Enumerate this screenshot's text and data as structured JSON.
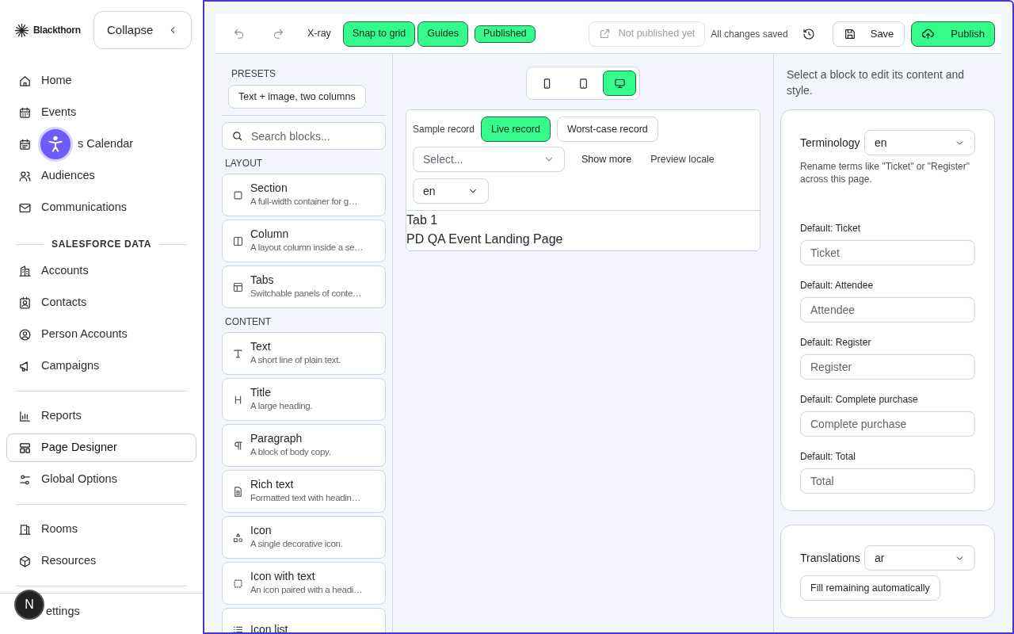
{
  "brand": {
    "name": "Blackthorn"
  },
  "collapse_button": {
    "label": "Collapse"
  },
  "sidebar": {
    "groups": [
      {
        "items": [
          {
            "label": "Home",
            "selected": false
          },
          {
            "label": "Events",
            "selected": false
          },
          {
            "label": "s Calendar",
            "selected": false
          },
          {
            "label": "Audiences",
            "selected": false
          },
          {
            "label": "Communications",
            "selected": false
          }
        ]
      },
      {
        "heading": "SALESFORCE DATA",
        "items": [
          {
            "label": "Accounts",
            "selected": false
          },
          {
            "label": "Contacts",
            "selected": false
          },
          {
            "label": "Person Accounts",
            "selected": false
          },
          {
            "label": "Campaigns",
            "selected": false
          }
        ]
      },
      {
        "items": [
          {
            "label": "Reports",
            "selected": false
          },
          {
            "label": "Page Designer",
            "selected": true
          },
          {
            "label": "Global Options",
            "selected": false
          }
        ]
      },
      {
        "items": [
          {
            "label": "Rooms",
            "selected": false
          },
          {
            "label": "Resources",
            "selected": false
          }
        ]
      }
    ],
    "footer_item": {
      "label": "ettings"
    },
    "avatar": {
      "initial": "N"
    }
  },
  "toolbar": {
    "toggles": [
      {
        "label": "X-ray",
        "on": false
      },
      {
        "label": "Snap to grid",
        "on": true
      },
      {
        "label": "Guides",
        "on": true
      }
    ],
    "status_badge": "Published",
    "view_link": {
      "label": "Not published yet",
      "disabled": true
    },
    "save_status": "All changes saved",
    "save_button": "Save",
    "publish_button": "Publish"
  },
  "blocks_panel": {
    "presets_heading": "PRESETS",
    "preset": "Text + image, two columns",
    "search": {
      "placeholder": "Search blocks..."
    },
    "sections": [
      {
        "heading": "LAYOUT",
        "blocks": [
          {
            "title": "Section",
            "description": "A full-width container for g…"
          },
          {
            "title": "Column",
            "description": "A layout column inside a se…"
          },
          {
            "title": "Tabs",
            "description": "Switchable panels of conte…"
          }
        ]
      },
      {
        "heading": "CONTENT",
        "blocks": [
          {
            "title": "Text",
            "description": "A short line of plain text."
          },
          {
            "title": "Title",
            "description": "A large heading."
          },
          {
            "title": "Paragraph",
            "description": "A block of body copy."
          },
          {
            "title": "Rich text",
            "description": "Formatted text with headin…"
          },
          {
            "title": "Icon",
            "description": "A single decorative icon."
          },
          {
            "title": "Icon with text",
            "description": "An icon paired with a headi…"
          },
          {
            "title": "Icon list"
          }
        ]
      }
    ]
  },
  "canvas": {
    "devices": [
      {
        "kind": "phone",
        "selected": false
      },
      {
        "kind": "tablet",
        "selected": false
      },
      {
        "kind": "desktop",
        "selected": true
      }
    ],
    "sample_record_label": "Sample record",
    "record_modes": [
      {
        "label": "Live record",
        "selected": true
      },
      {
        "label": "Worst-case record",
        "selected": false
      }
    ],
    "record_select": {
      "placeholder": "Select..."
    },
    "show_more": "Show more",
    "preview_locale_label": "Preview locale",
    "locale": "en",
    "preview_lines": [
      "Tab 1",
      "PD QA Event Landing Page"
    ]
  },
  "inspector": {
    "hint": "Select a block to edit its content and style.",
    "terminology": {
      "title": "Terminology",
      "locale": "en",
      "description": "Rename terms like \"Ticket\" or \"Register\" across this page.",
      "fields": [
        {
          "label": "Default: Ticket",
          "placeholder": "Ticket"
        },
        {
          "label": "Default: Attendee",
          "placeholder": "Attendee"
        },
        {
          "label": "Default: Register",
          "placeholder": "Register"
        },
        {
          "label": "Default: Complete purchase",
          "placeholder": "Complete purchase"
        },
        {
          "label": "Default: Total",
          "placeholder": "Total"
        }
      ]
    },
    "translations": {
      "title": "Translations",
      "locale": "ar",
      "button": "Fill remaining automatically"
    }
  }
}
